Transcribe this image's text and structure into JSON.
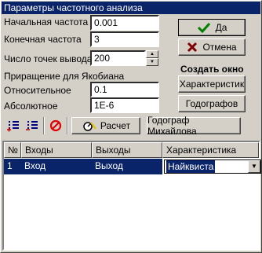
{
  "window": {
    "title": "Параметры частотного анализа"
  },
  "form": {
    "start_freq_label": "Начальная частота",
    "start_freq_value": "0.001",
    "end_freq_label": "Конечная частота",
    "end_freq_value": "3",
    "points_label": "Число точек вывода",
    "points_value": "200",
    "jacobian_label": "Приращение для Якобиана",
    "relative_label": "Относительное",
    "relative_value": "0.1",
    "absolute_label": "Абсолютное",
    "absolute_value": "1E-6"
  },
  "buttons": {
    "ok": "Да",
    "cancel": "Отмена",
    "create_window_label": "Создать окно",
    "characteristics": "Характеристик",
    "hodographs": "Годографов",
    "calculate": "Расчет",
    "mikhailov": "Годограф Михайлова"
  },
  "table": {
    "headers": [
      "№",
      "Входы",
      "Выходы",
      "Характеристика"
    ],
    "rows": [
      {
        "num": "1",
        "input": "Вход",
        "output": "Выход",
        "characteristic": "Найквиста"
      }
    ]
  },
  "colors": {
    "selection": "#0a246a",
    "ok_check": "#008000",
    "cancel_x": "#800000"
  }
}
